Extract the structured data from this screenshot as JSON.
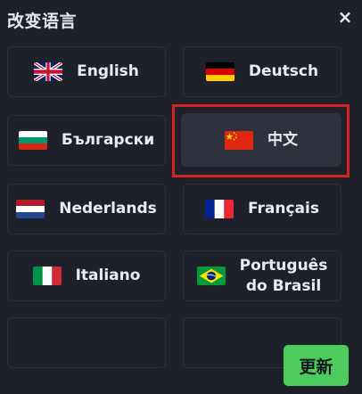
{
  "dialog": {
    "title": "改变语言",
    "close_symbol": "×",
    "update_label": "更新"
  },
  "languages": [
    {
      "label": "English",
      "flag": "uk-flag-icon"
    },
    {
      "label": "Deutsch",
      "flag": "germany-flag-icon"
    },
    {
      "label": "Български",
      "flag": "bulgaria-flag-icon"
    },
    {
      "label": "中文",
      "flag": "china-flag-icon",
      "selected": true
    },
    {
      "label": "Nederlands",
      "flag": "netherlands-flag-icon"
    },
    {
      "label": "Français",
      "flag": "france-flag-icon"
    },
    {
      "label": "Italiano",
      "flag": "italy-flag-icon"
    },
    {
      "label": "Português do Brasil",
      "label_line1": "Português",
      "label_line2": "do Brasil",
      "flag": "brazil-flag-icon"
    }
  ],
  "colors": {
    "background": "#1e2129",
    "tile_border": "#2c3039",
    "selected_tile": "#2f323c",
    "highlight": "#d42323",
    "accent_button": "#4dcc5d"
  }
}
